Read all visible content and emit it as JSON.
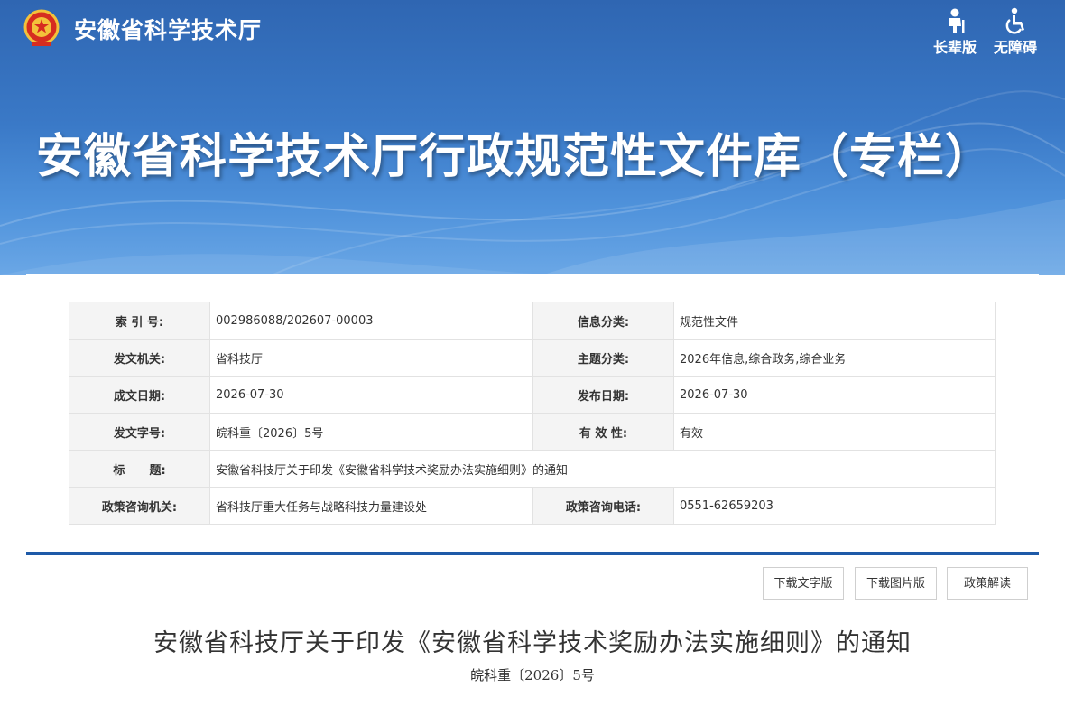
{
  "header": {
    "site_name": "安徽省科学技术厅",
    "elder_label": "长辈版",
    "accessible_label": "无障碍",
    "banner_title": "安徽省科学技术厅行政规范性文件库（专栏）"
  },
  "meta": {
    "index_no": {
      "key": "索 引 号:",
      "value": "002986088/202607-00003"
    },
    "info_category": {
      "key": "信息分类:",
      "value": "规范性文件"
    },
    "issuer": {
      "key": "发文机关:",
      "value": "省科技厅"
    },
    "topic_category": {
      "key": "主题分类:",
      "value": "2026年信息,综合政务,综合业务"
    },
    "created_date": {
      "key": "成文日期:",
      "value": "2026-07-30"
    },
    "published_date": {
      "key": "发布日期:",
      "value": "2026-07-30"
    },
    "doc_number": {
      "key": "发文字号:",
      "value": "皖科重〔2026〕5号"
    },
    "validity": {
      "key": "有 效 性:",
      "value": "有效"
    },
    "title": {
      "key": "标      题:",
      "value": "安徽省科技厅关于印发《安徽省科学技术奖励办法实施细则》的通知"
    },
    "consult_office": {
      "key": "政策咨询机关:",
      "value": "省科技厅重大任务与战略科技力量建设处"
    },
    "consult_phone": {
      "key": "政策咨询电话:",
      "value": "0551-62659203"
    }
  },
  "actions": {
    "download_text": "下载文字版",
    "download_image": "下载图片版",
    "policy_interpretation": "政策解读"
  },
  "document": {
    "title": "安徽省科技厅关于印发《安徽省科学技术奖励办法实施细则》的通知",
    "number": "皖科重〔2026〕5号"
  },
  "colors": {
    "banner_top": "#2f66b2",
    "banner_bottom": "#6aa7e6",
    "accent_bar": "#1e5aa8",
    "key_cell_bg": "#f4f4f4"
  }
}
